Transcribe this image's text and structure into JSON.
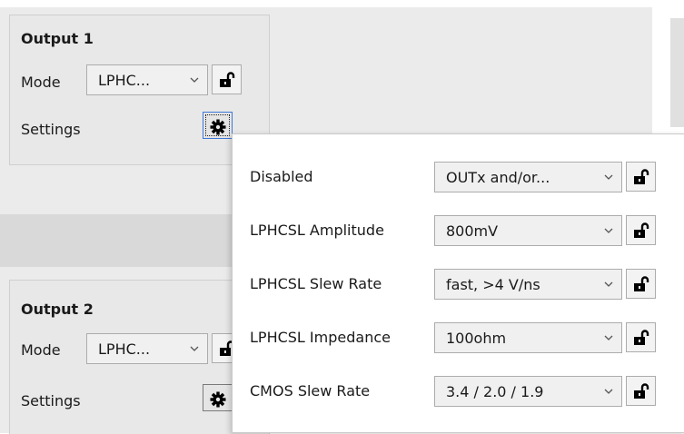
{
  "output1": {
    "title": "Output 1",
    "mode_label": "Mode",
    "mode_value": "LPHC...",
    "settings_label": "Settings"
  },
  "output2": {
    "title": "Output 2",
    "mode_label": "Mode",
    "mode_value": "LPHC...",
    "settings_label": "Settings"
  },
  "settings_popup": {
    "rows": [
      {
        "label": "Disabled",
        "value": "OUTx and/or..."
      },
      {
        "label": "LPHCSL Amplitude",
        "value": "800mV"
      },
      {
        "label": "LPHCSL Slew Rate",
        "value": "fast, >4 V/ns"
      },
      {
        "label": "LPHCSL Impedance",
        "value": "100ohm"
      },
      {
        "label": "CMOS Slew Rate",
        "value": "3.4 / 2.0 / 1.9"
      }
    ]
  },
  "icons": {
    "lock": "unlocked-padlock-icon",
    "settings": "gear-icon",
    "dropdown": "chevron-down-icon"
  }
}
